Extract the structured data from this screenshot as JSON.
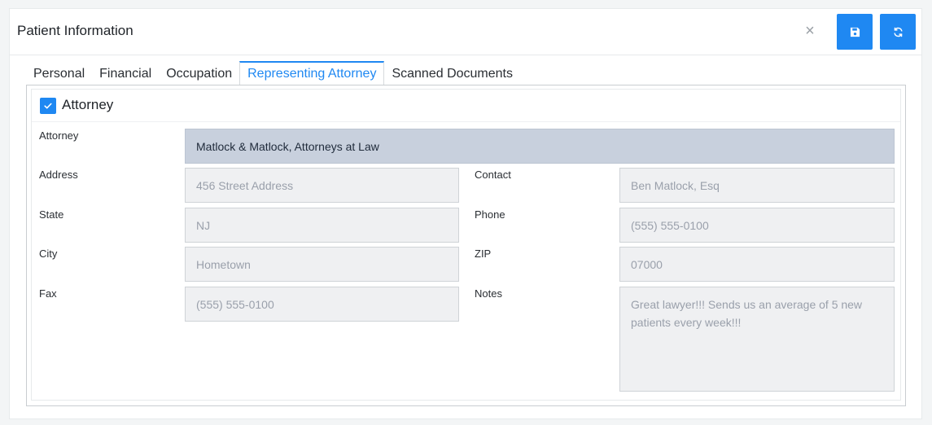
{
  "header": {
    "title": "Patient Information",
    "close_label": "×"
  },
  "tabs": [
    {
      "label": "Personal"
    },
    {
      "label": "Financial"
    },
    {
      "label": "Occupation"
    },
    {
      "label": "Representing Attorney"
    },
    {
      "label": "Scanned Documents"
    }
  ],
  "active_tab": "Representing Attorney",
  "attorney_toggle": {
    "label": "Attorney",
    "checked": true
  },
  "fields": {
    "attorney": {
      "label": "Attorney",
      "value": "Matlock & Matlock, Attorneys at Law"
    },
    "address": {
      "label": "Address",
      "value": "456 Street Address"
    },
    "state": {
      "label": "State",
      "value": "NJ"
    },
    "city": {
      "label": "City",
      "value": "Hometown"
    },
    "fax": {
      "label": "Fax",
      "value": "(555) 555-0100"
    },
    "contact": {
      "label": "Contact",
      "value": "Ben Matlock, Esq"
    },
    "phone": {
      "label": "Phone",
      "value": "(555) 555-0100"
    },
    "zip": {
      "label": "ZIP",
      "value": "07000"
    },
    "notes": {
      "label": "Notes",
      "value": "Great lawyer!!! Sends us an average of 5 new patients every week!!!"
    }
  },
  "icons": {
    "save": "floppy-disk-icon",
    "refresh": "refresh-icon",
    "close": "close-icon",
    "check": "check-icon"
  },
  "colors": {
    "accent": "#1f88f2",
    "selected_field": "#c8d0dd",
    "readonly_field": "#eff0f2"
  }
}
